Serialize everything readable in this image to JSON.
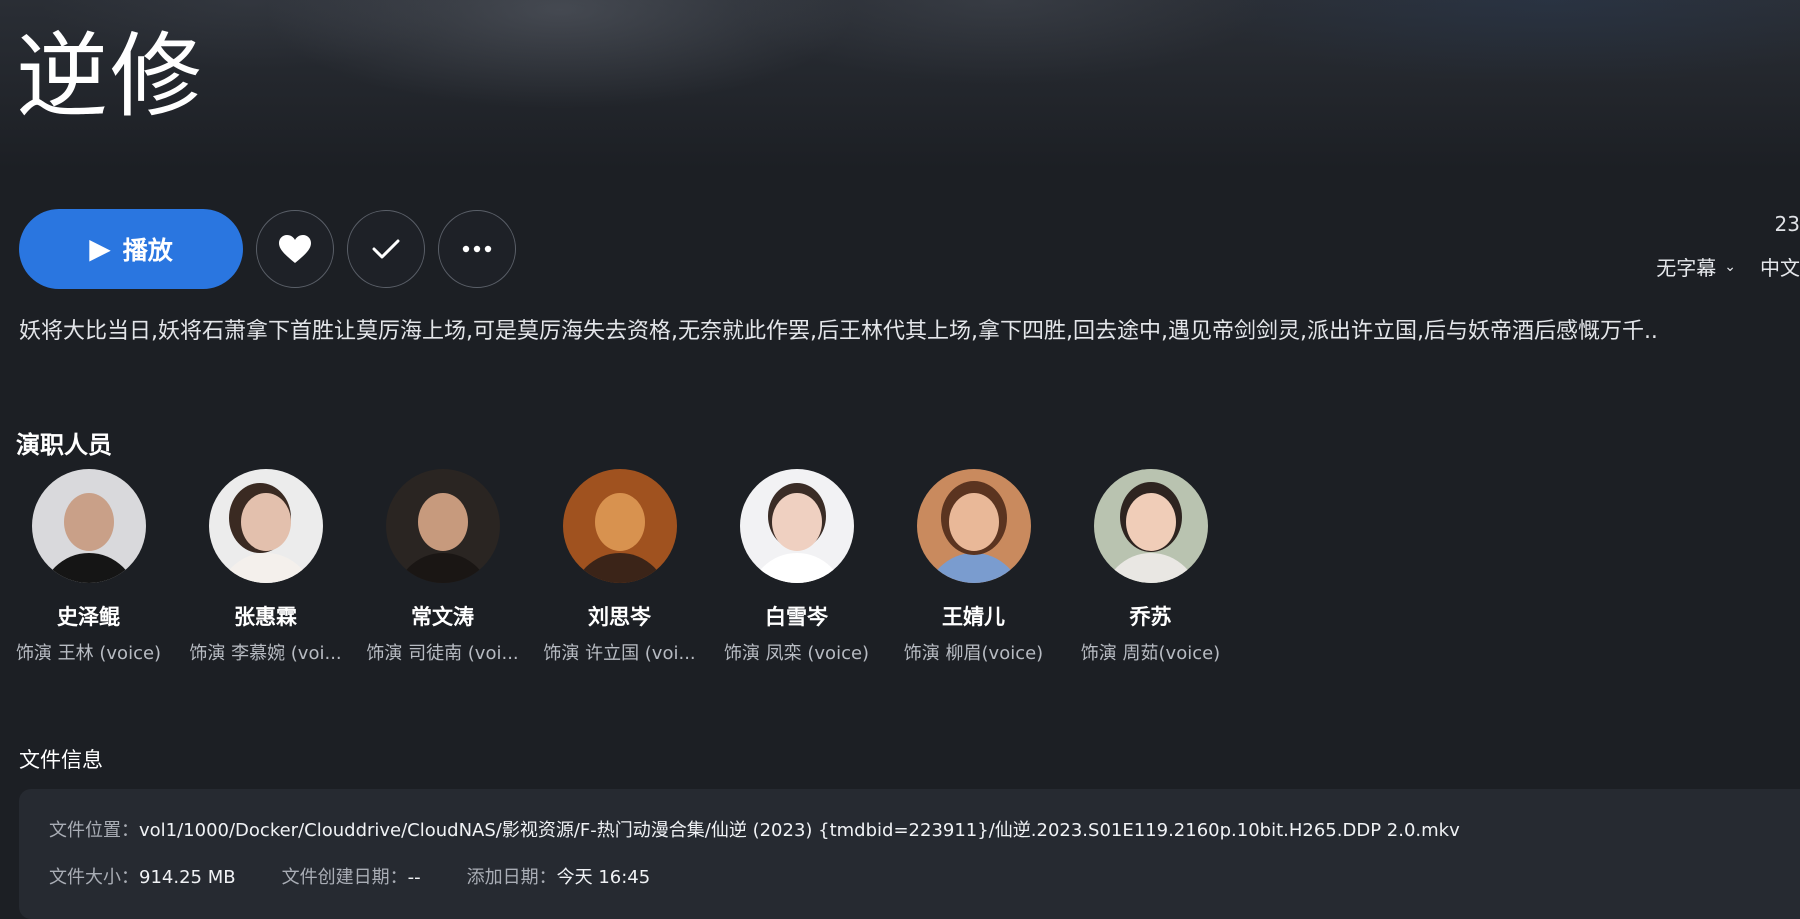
{
  "title": "逆修",
  "actions": {
    "play_label": "播放",
    "play_icon": "play-icon",
    "favorite_icon": "heart-icon",
    "watched_icon": "check-icon",
    "more_icon": "more-dots-icon",
    "accent_color": "#2a76e0"
  },
  "right_meta": {
    "number_text": "23",
    "subtitle_select": "无字幕",
    "audio_select": "中文"
  },
  "overview": "妖将大比当日,妖将石萧拿下首胜让莫厉海上场,可是莫厉海失去资格,无奈就此作罢,后王林代其上场,拿下四胜,回去途中,遇见帝剑剑灵,派出许立国,后与妖帝酒后感慨万千..",
  "cast": {
    "title": "演职人员",
    "members": [
      {
        "name": "史泽鲲",
        "role": "饰演 王林 (voice)"
      },
      {
        "name": "张惠霖",
        "role": "饰演 李慕婉 (voi..."
      },
      {
        "name": "常文涛",
        "role": "饰演 司徒南 (voi..."
      },
      {
        "name": "刘思岑",
        "role": "饰演 许立国 (voi..."
      },
      {
        "name": "白雪岑",
        "role": "饰演 凤栾 (voice)"
      },
      {
        "name": "王婧儿",
        "role": "饰演 柳眉(voice)"
      },
      {
        "name": "乔苏",
        "role": "饰演 周茹(voice)"
      }
    ]
  },
  "file_info": {
    "title": "文件信息",
    "location_label": "文件位置：",
    "location_value": "vol1/1000/Docker/Clouddrive/CloudNAS/影视资源/F-热门动漫合集/仙逆 (2023) {tmdbid=223911}/仙逆.2023.S01E119.2160p.10bit.H265.DDP 2.0.mkv",
    "size_label": "文件大小：",
    "size_value": "914.25 MB",
    "created_label": "文件创建日期：",
    "created_value": "--",
    "added_label": "添加日期：",
    "added_value": "今天 16:45"
  }
}
